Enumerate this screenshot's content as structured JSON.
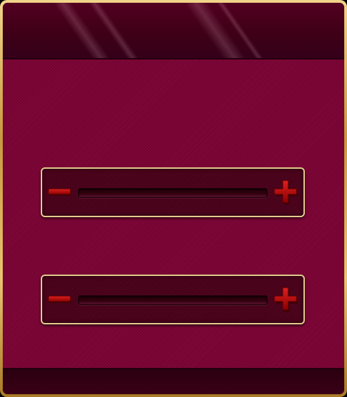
{
  "colors": {
    "frame_gold": "#c89a3c",
    "panel_border": "#e6cd8e",
    "background": "#7a0032",
    "bar": "#3d0017",
    "button_red": "#b80000"
  },
  "sliders": [
    {
      "decrease_icon": "minus-icon",
      "increase_icon": "plus-icon",
      "level": 0
    },
    {
      "decrease_icon": "minus-icon",
      "increase_icon": "plus-icon",
      "level": 0
    }
  ]
}
